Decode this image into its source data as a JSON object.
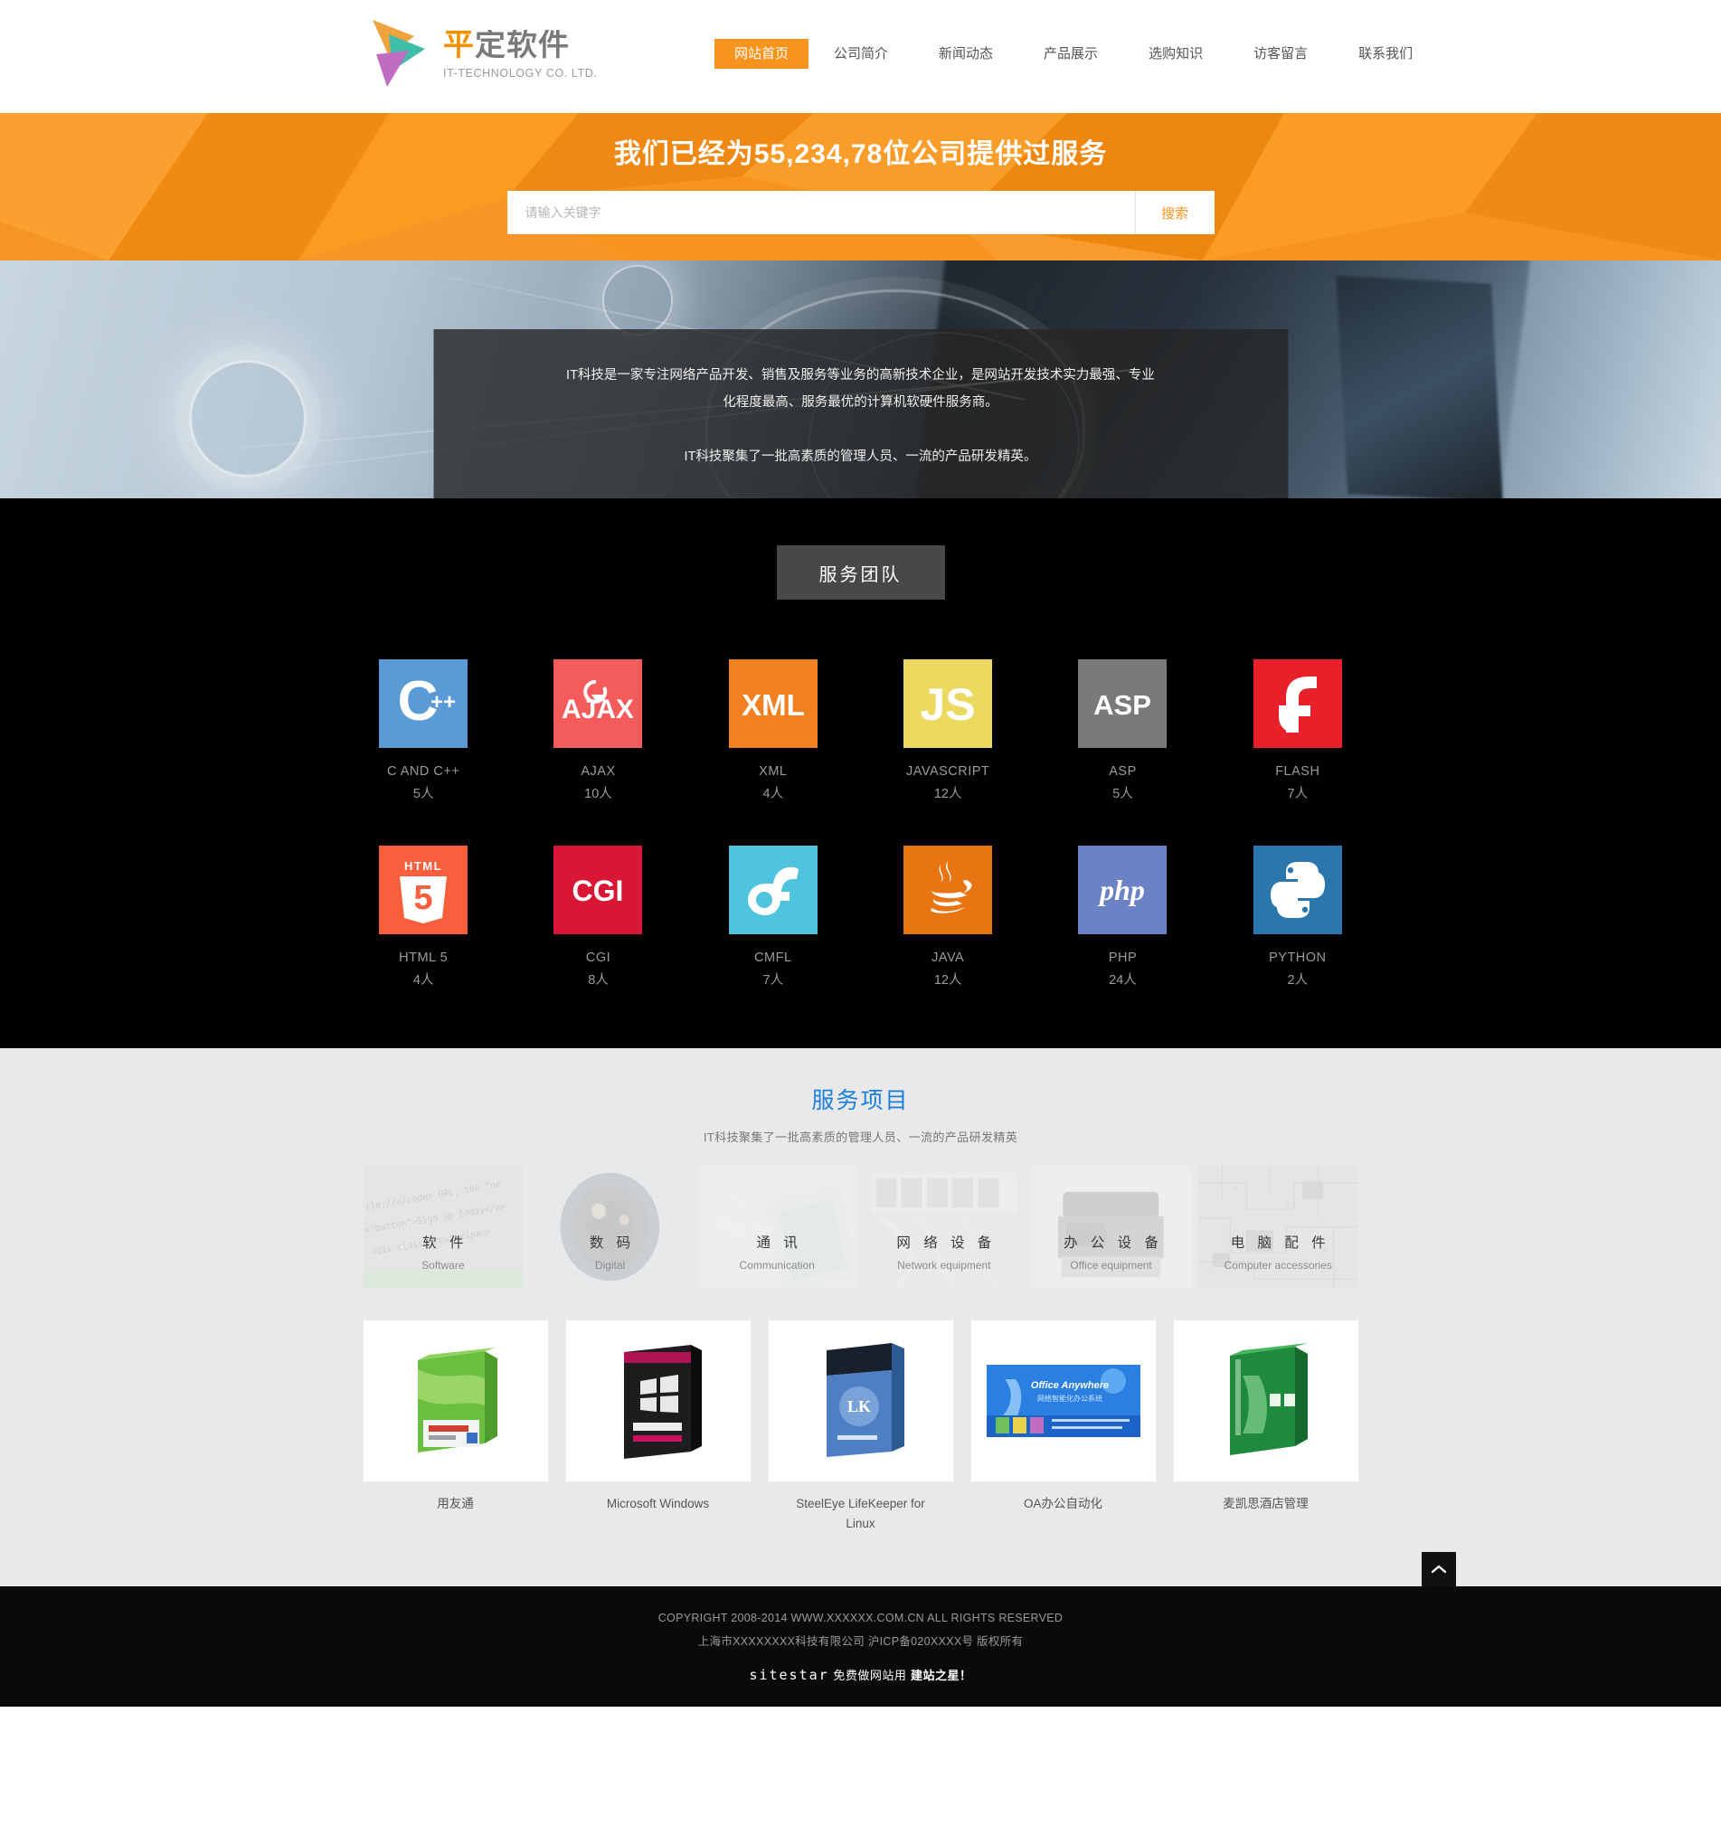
{
  "site": {
    "logo_cn": "平定软件",
    "logo_en": "IT-TECHNOLOGY CO. LTD."
  },
  "nav": {
    "items": [
      {
        "label": "网站首页",
        "active": true
      },
      {
        "label": "公司简介",
        "active": false
      },
      {
        "label": "新闻动态",
        "active": false
      },
      {
        "label": "产品展示",
        "active": false
      },
      {
        "label": "选购知识",
        "active": false
      },
      {
        "label": "访客留言",
        "active": false
      },
      {
        "label": "联系我们",
        "active": false
      }
    ]
  },
  "search_banner": {
    "title": "我们已经为55,234,78位公司提供过服务",
    "placeholder": "请输入关键字",
    "button": "搜索",
    "bg_color": "#f7941e"
  },
  "hero": {
    "paragraph1": "IT科技是一家专注网络产品开发、销售及服务等业务的高新技术企业，是网站开发技术实力最强、专业化程度最高、服务最优的计算机软硬件服务商。",
    "paragraph2": "IT科技聚集了一批高素质的管理人员、一流的产品研发精英。"
  },
  "team": {
    "badge": "服务团队",
    "techs": [
      {
        "icon": "cpp-icon",
        "glyph": "C++",
        "name": "C AND C++",
        "count": "5人",
        "color": "#5b9bd5"
      },
      {
        "icon": "ajax-icon",
        "glyph": "AJAX",
        "name": "AJAX",
        "count": "10人",
        "color": "#f45b5b"
      },
      {
        "icon": "xml-icon",
        "glyph": "XML",
        "name": "XML",
        "count": "4人",
        "color": "#f18020"
      },
      {
        "icon": "js-icon",
        "glyph": "JS",
        "name": "JAVASCRIPT",
        "count": "12人",
        "color": "#ecd960"
      },
      {
        "icon": "asp-icon",
        "glyph": "ASP",
        "name": "ASP",
        "count": "5人",
        "color": "#7a7a7a"
      },
      {
        "icon": "flash-icon",
        "glyph": "f",
        "name": "FLASH",
        "count": "7人",
        "color": "#e8202a"
      },
      {
        "icon": "html5-icon",
        "glyph": "5",
        "name": "HTML 5",
        "count": "4人",
        "color": "#f95f3c"
      },
      {
        "icon": "cgi-icon",
        "glyph": "CGI",
        "name": "CGI",
        "count": "8人",
        "color": "#d81635"
      },
      {
        "icon": "cmfl-icon",
        "glyph": "cf",
        "name": "CMFL",
        "count": "7人",
        "color": "#50c3dd"
      },
      {
        "icon": "java-icon",
        "glyph": "☕",
        "name": "JAVA",
        "count": "12人",
        "color": "#e87511"
      },
      {
        "icon": "php-icon",
        "glyph": "php",
        "name": "PHP",
        "count": "24人",
        "color": "#6b82c4"
      },
      {
        "icon": "python-icon",
        "glyph": "py",
        "name": "PYTHON",
        "count": "2人",
        "color": "#2c76ae"
      }
    ]
  },
  "projects": {
    "title": "服务项目",
    "subtitle": "IT科技聚集了一批高素质的管理人员、一流的产品研发精英",
    "title_color": "#1a7fdb",
    "categories": [
      {
        "cn": "软 件",
        "en": "Software",
        "img": "code-photo"
      },
      {
        "cn": "数 码",
        "en": "Digital",
        "img": "camera-lens-photo"
      },
      {
        "cn": "通 讯",
        "en": "Communication",
        "img": "phone-earbuds-photo"
      },
      {
        "cn": "网 络 设 备",
        "en": "Network equipment",
        "img": "network-rack-photo"
      },
      {
        "cn": "办 公 设 备",
        "en": "Office equipment",
        "img": "printer-photo"
      },
      {
        "cn": "电 脑 配 件",
        "en": "Computer accessories",
        "img": "circuit-board-photo"
      }
    ],
    "products": [
      {
        "name": "用友通",
        "img": "green-software-box"
      },
      {
        "name": "Microsoft Windows",
        "img": "windows7-box"
      },
      {
        "name": "SteelEye LifeKeeper for Linux",
        "img": "blue-software-box"
      },
      {
        "name": "OA办公自动化",
        "img": "office-anywhere-banner"
      },
      {
        "name": "麦凯思酒店管理",
        "img": "green-hotel-box"
      }
    ],
    "back_to_top_icon": "chevron-up-icon"
  },
  "footer": {
    "line1": "COPYRIGHT 2008-2014 WWW.XXXXXX.COM.CN ALL RIGHTS RESERVED",
    "line2": "上海市XXXXXXXX科技有限公司   沪ICP备020XXXX号  版权所有",
    "sitestar_logo": "sitestar",
    "sitestar_text1": "免费做网站用",
    "sitestar_text2": "建站之星！"
  }
}
